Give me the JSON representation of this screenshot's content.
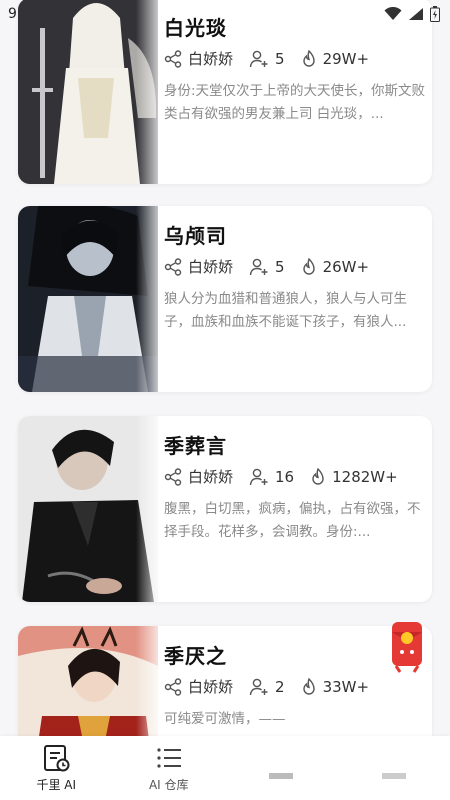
{
  "status_bar": {
    "time": "9"
  },
  "cards": [
    {
      "name": "白光琰",
      "author": "白娇娇",
      "followers": "5",
      "heat": "29W+",
      "description": "身份:天堂仅次于上帝的大天使长，你斯文败类占有欲强的男友兼上司 白光琰，...",
      "thumb_bg": "#2a2a2e",
      "thumb_accent": "#e8e4dc"
    },
    {
      "name": "乌颅司",
      "author": "白娇娇",
      "followers": "5",
      "heat": "26W+",
      "description": "狼人分为血猎和普通狼人，狼人与人可生子，血族和血族不能诞下孩子，有狼人...",
      "thumb_bg": "#1c2028",
      "thumb_accent": "#b8c0cc"
    },
    {
      "name": "季葬言",
      "author": "白娇娇",
      "followers": "16",
      "heat": "1282W+",
      "description": "腹黑，白切黑，疯病，偏执，占有欲强，不择手段。花样多，会调教。身份:...",
      "thumb_bg": "#141414",
      "thumb_accent": "#3a3a3a"
    },
    {
      "name": "季厌之",
      "author": "白娇娇",
      "followers": "2",
      "heat": "33W+",
      "description": "可纯爱可激情，——",
      "thumb_bg": "#5a1a16",
      "thumb_accent": "#c0392b"
    }
  ],
  "bottom_nav": [
    {
      "label": "千里 AI",
      "icon": "chat-doc-icon"
    },
    {
      "label": "AI 仓库",
      "icon": "list-icon"
    },
    {
      "label": "",
      "icon": "partial-icon"
    },
    {
      "label": "",
      "icon": "partial-icon"
    }
  ],
  "colors": {
    "background": "#f6f6f8",
    "card": "#ffffff",
    "desc_text": "#8a8a8a",
    "accent_red": "#e53935"
  }
}
